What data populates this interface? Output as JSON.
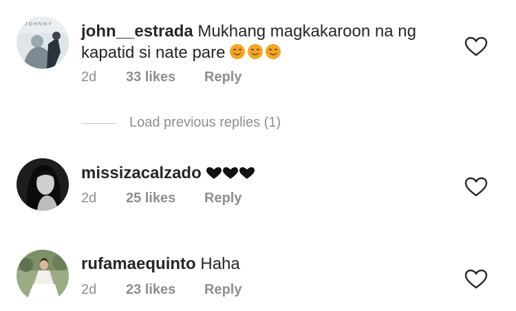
{
  "comments": [
    {
      "username": "john__estrada",
      "text": "Mukhang magkakaroon na ng kapatid si nate pare",
      "emoji_count": 3,
      "time": "2d",
      "likes": "33 likes",
      "reply_label": "Reply",
      "avatar_icon": "avatar-johnny-poster"
    },
    {
      "username": "missizacalzado",
      "text": "",
      "emoji_count": 3,
      "time": "2d",
      "likes": "25 likes",
      "reply_label": "Reply",
      "avatar_icon": "avatar-portrait-bw"
    },
    {
      "username": "rufamaequinto",
      "text": "Haha",
      "time": "2d",
      "likes": "23 likes",
      "reply_label": "Reply",
      "avatar_icon": "avatar-wedding-photo"
    }
  ],
  "load_previous_replies": "Load previous replies (1)",
  "colors": {
    "text": "#262626",
    "secondary": "#8e8e8e",
    "emoji": "#f5a623",
    "heart": "#262626"
  }
}
